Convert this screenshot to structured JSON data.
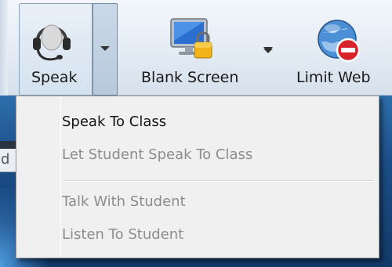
{
  "toolbar": {
    "speak": {
      "label": "Speak",
      "icon": "headset-icon"
    },
    "blank_screen": {
      "label": "Blank Screen",
      "icon": "monitor-lock-icon"
    },
    "limit_web": {
      "label": "Limit Web",
      "icon": "globe-block-icon"
    }
  },
  "background": {
    "partial_letter": "d"
  },
  "menu": {
    "items": [
      {
        "label": "Speak To Class",
        "enabled": true
      },
      {
        "label": "Let Student Speak To Class",
        "enabled": false
      },
      {
        "label": "Talk With Student",
        "enabled": false
      },
      {
        "label": "Listen To Student",
        "enabled": false
      }
    ]
  },
  "colors": {
    "toolbar_bg": "#e3ebf4",
    "menu_bg": "#f0f0f0",
    "menu_text_enabled": "#151515",
    "menu_text_disabled": "#8d8d8d",
    "desktop_bg": "#1d4e83"
  }
}
